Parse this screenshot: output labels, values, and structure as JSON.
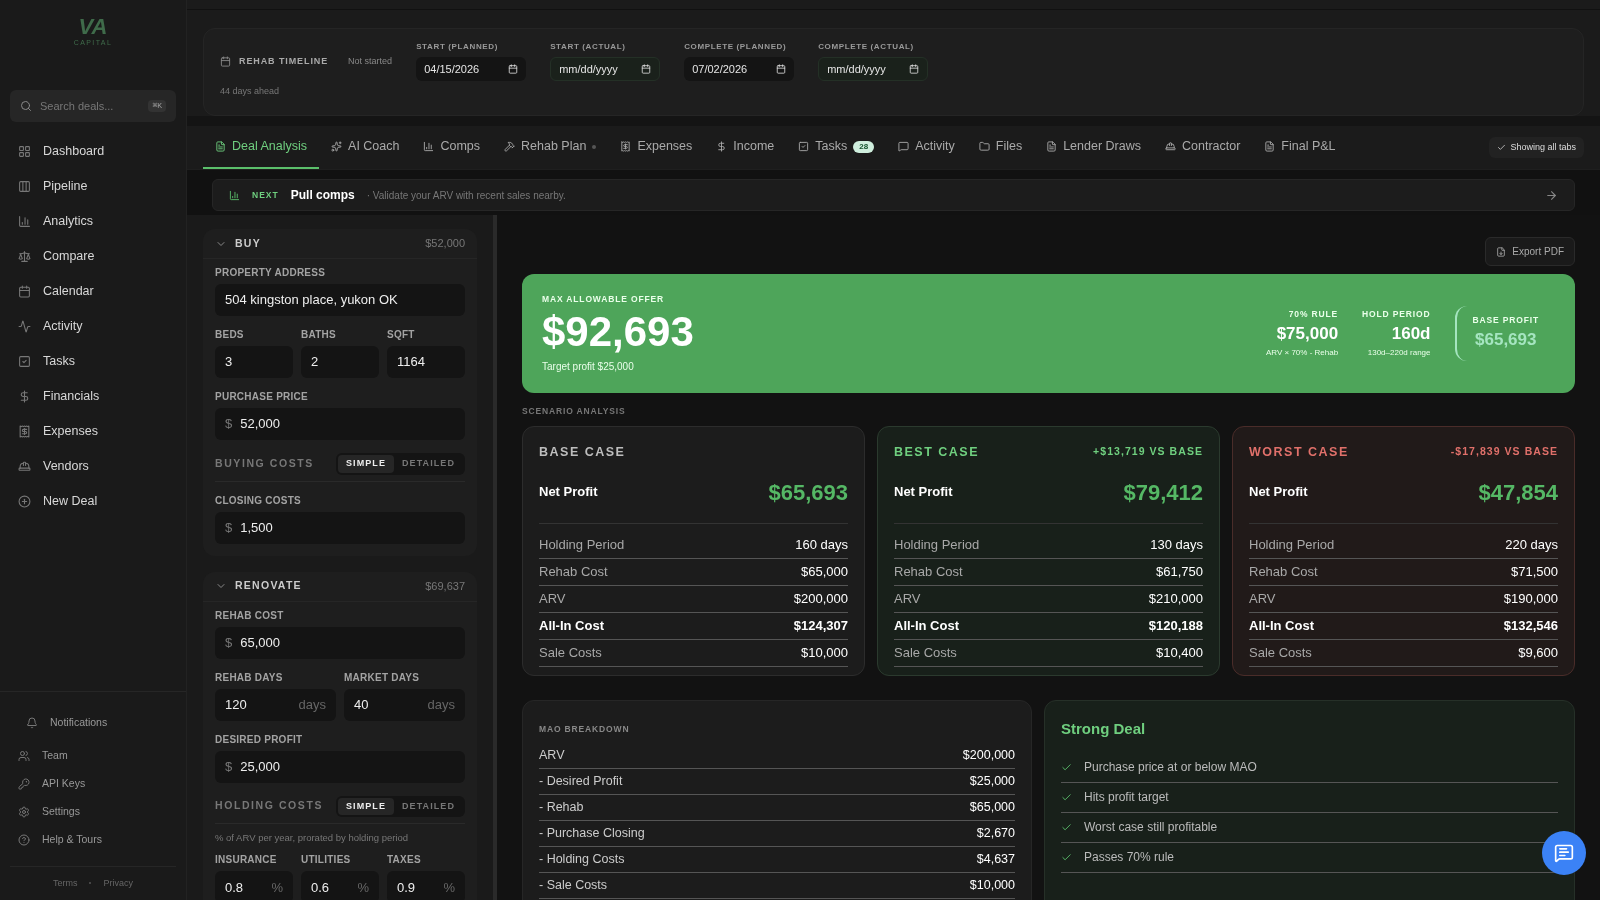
{
  "logo": {
    "mark": "VA",
    "sub": "CAPITAL"
  },
  "search": {
    "placeholder": "Search deals...",
    "shortcut": "⌘K"
  },
  "nav": [
    {
      "label": "Dashboard",
      "selected": false
    },
    {
      "label": "Pipeline",
      "selected": false
    },
    {
      "label": "Analytics",
      "selected": false
    },
    {
      "label": "Compare",
      "selected": false
    },
    {
      "label": "Calendar",
      "selected": false
    },
    {
      "label": "Activity",
      "selected": false
    },
    {
      "label": "Tasks",
      "selected": false
    },
    {
      "label": "Financials",
      "selected": false
    },
    {
      "label": "Expenses",
      "selected": false
    },
    {
      "label": "Vendors",
      "selected": false
    },
    {
      "label": "New Deal",
      "selected": false
    }
  ],
  "bottom_nav": [
    {
      "label": "Notifications"
    },
    {
      "label": "Team"
    },
    {
      "label": "API Keys"
    },
    {
      "label": "Settings"
    },
    {
      "label": "Help & Tours"
    }
  ],
  "footer_links": [
    "Terms",
    "Privacy"
  ],
  "timeline": {
    "title": "REHAB TIMELINE",
    "status": "Not started",
    "note": "44 days ahead",
    "dates": [
      {
        "label": "START (PLANNED)",
        "value": "04/15/2026"
      },
      {
        "label": "START (ACTUAL)",
        "placeholder": "mm/dd/yyyy"
      },
      {
        "label": "COMPLETE (PLANNED)",
        "value": "07/02/2026"
      },
      {
        "label": "COMPLETE (ACTUAL)",
        "placeholder": "mm/dd/yyyy"
      }
    ]
  },
  "tabs": [
    {
      "label": "Deal Analysis",
      "selected": true,
      "dot": false
    },
    {
      "label": "AI Coach",
      "selected": false,
      "dot": false
    },
    {
      "label": "Comps",
      "selected": false,
      "dot": false
    },
    {
      "label": "Rehab Plan",
      "selected": false,
      "dot": true
    },
    {
      "label": "Expenses",
      "selected": false,
      "dot": false
    },
    {
      "label": "Income",
      "selected": false,
      "dot": false
    },
    {
      "label": "Tasks",
      "selected": false,
      "dot": false,
      "badge": "28"
    },
    {
      "label": "Activity",
      "selected": false,
      "dot": false
    },
    {
      "label": "Files",
      "selected": false,
      "dot": false
    },
    {
      "label": "Lender Draws",
      "selected": false,
      "dot": false
    },
    {
      "label": "Contractor",
      "selected": false,
      "dot": false
    },
    {
      "label": "Final P&L",
      "selected": false,
      "dot": false
    }
  ],
  "show_all": "Showing all tabs",
  "next": {
    "tag": "NEXT",
    "title": "Pull comps",
    "hint": "· Validate your ARV with recent sales nearby."
  },
  "sections": [
    {
      "title": "BUY",
      "total": "$52,000",
      "expanded": true,
      "items": [
        {
          "kind": "fields",
          "fields": [
            {
              "label": "PROPERTY ADDRESS",
              "value": "504 kingston place, yukon OK"
            }
          ]
        },
        {
          "kind": "fields",
          "fields": [
            {
              "label": "BEDS",
              "value": "3"
            },
            {
              "label": "BATHS",
              "value": "2"
            },
            {
              "label": "SQFT",
              "value": "1164"
            }
          ]
        },
        {
          "kind": "fields",
          "fields": [
            {
              "label": "PURCHASE PRICE",
              "prefix": "$",
              "value": "52,000"
            }
          ]
        },
        {
          "kind": "mode",
          "label": "BUYING COSTS",
          "options": [
            {
              "label": "SIMPLE",
              "selected": true
            },
            {
              "label": "DETAILED",
              "selected": false
            }
          ]
        },
        {
          "kind": "fields",
          "fields": [
            {
              "label": "CLOSING COSTS",
              "prefix": "$",
              "value": "1,500"
            }
          ]
        }
      ]
    },
    {
      "title": "RENOVATE",
      "total": "$69,637",
      "expanded": true,
      "items": [
        {
          "kind": "fields",
          "fields": [
            {
              "label": "REHAB COST",
              "prefix": "$",
              "value": "65,000"
            }
          ]
        },
        {
          "kind": "fields",
          "fields": [
            {
              "label": "REHAB DAYS",
              "value": "120",
              "suffix": "days"
            },
            {
              "label": "MARKET DAYS",
              "value": "40",
              "suffix": "days"
            }
          ]
        },
        {
          "kind": "fields",
          "fields": [
            {
              "label": "DESIRED PROFIT",
              "prefix": "$",
              "value": "25,000"
            }
          ]
        },
        {
          "kind": "mode",
          "label": "HOLDING COSTS",
          "options": [
            {
              "label": "SIMPLE",
              "selected": true
            },
            {
              "label": "DETAILED",
              "selected": false
            }
          ]
        },
        {
          "kind": "note",
          "text": "% of ARV per year, prorated by holding period"
        },
        {
          "kind": "fields",
          "fields": [
            {
              "label": "INSURANCE",
              "value": "0.8",
              "suffix": "%"
            },
            {
              "label": "UTILITIES",
              "value": "0.6",
              "suffix": "%"
            },
            {
              "label": "TAXES",
              "value": "0.9",
              "suffix": "%"
            }
          ]
        }
      ]
    }
  ],
  "export": "Export PDF",
  "mao": {
    "label": "MAX ALLOWABLE OFFER",
    "value": "$92,693",
    "sub": "Target profit $25,000",
    "stats": [
      {
        "label": "70% RULE",
        "value": "$75,000",
        "sub": "ARV × 70% - Rehab"
      },
      {
        "label": "HOLD PERIOD",
        "value": "160d",
        "sub": "130d–220d range"
      }
    ],
    "highlight": {
      "label": "BASE PROFIT",
      "value": "$65,693"
    }
  },
  "scenario_title": "SCENARIO ANALYSIS",
  "cases": [
    {
      "kind": "base",
      "title": "BASE CASE",
      "profit_label": "Net Profit",
      "profit": "$65,693",
      "rows": [
        {
          "label": "Holding Period",
          "value": "160 days",
          "bold": false
        },
        {
          "label": "Rehab Cost",
          "value": "$65,000",
          "bold": false
        },
        {
          "label": "ARV",
          "value": "$200,000",
          "bold": false
        },
        {
          "label": "All-In Cost",
          "value": "$124,307",
          "bold": true
        },
        {
          "label": "Sale Costs",
          "value": "$10,000",
          "bold": false
        }
      ]
    },
    {
      "kind": "best",
      "title": "BEST CASE",
      "delta": "+$13,719 VS BASE",
      "profit_label": "Net Profit",
      "profit": "$79,412",
      "rows": [
        {
          "label": "Holding Period",
          "value": "130 days",
          "bold": false
        },
        {
          "label": "Rehab Cost",
          "value": "$61,750",
          "bold": false
        },
        {
          "label": "ARV",
          "value": "$210,000",
          "bold": false
        },
        {
          "label": "All-In Cost",
          "value": "$120,188",
          "bold": true
        },
        {
          "label": "Sale Costs",
          "value": "$10,400",
          "bold": false
        }
      ]
    },
    {
      "kind": "worst",
      "title": "WORST CASE",
      "delta": "-$17,839 VS BASE",
      "profit_label": "Net Profit",
      "profit": "$47,854",
      "rows": [
        {
          "label": "Holding Period",
          "value": "220 days",
          "bold": false
        },
        {
          "label": "Rehab Cost",
          "value": "$71,500",
          "bold": false
        },
        {
          "label": "ARV",
          "value": "$190,000",
          "bold": false
        },
        {
          "label": "All-In Cost",
          "value": "$132,546",
          "bold": true
        },
        {
          "label": "Sale Costs",
          "value": "$9,600",
          "bold": false
        }
      ]
    }
  ],
  "breakdown": {
    "title": "MAO BREAKDOWN",
    "rows": [
      {
        "label": "ARV",
        "value": "$200,000"
      },
      {
        "label": "- Desired Profit",
        "value": "$25,000"
      },
      {
        "label": "- Rehab",
        "value": "$65,000"
      },
      {
        "label": "- Purchase Closing",
        "value": "$2,670"
      },
      {
        "label": "- Holding Costs",
        "value": "$4,637"
      },
      {
        "label": "- Sale Costs",
        "value": "$10,000"
      }
    ]
  },
  "verdict": {
    "title": "Strong Deal",
    "checks": [
      {
        "label": "Purchase price at or below MAO",
        "checked": true
      },
      {
        "label": "Hits profit target",
        "checked": true
      },
      {
        "label": "Worst case still profitable",
        "checked": true
      },
      {
        "label": "Passes 70% rule",
        "checked": true
      }
    ]
  }
}
